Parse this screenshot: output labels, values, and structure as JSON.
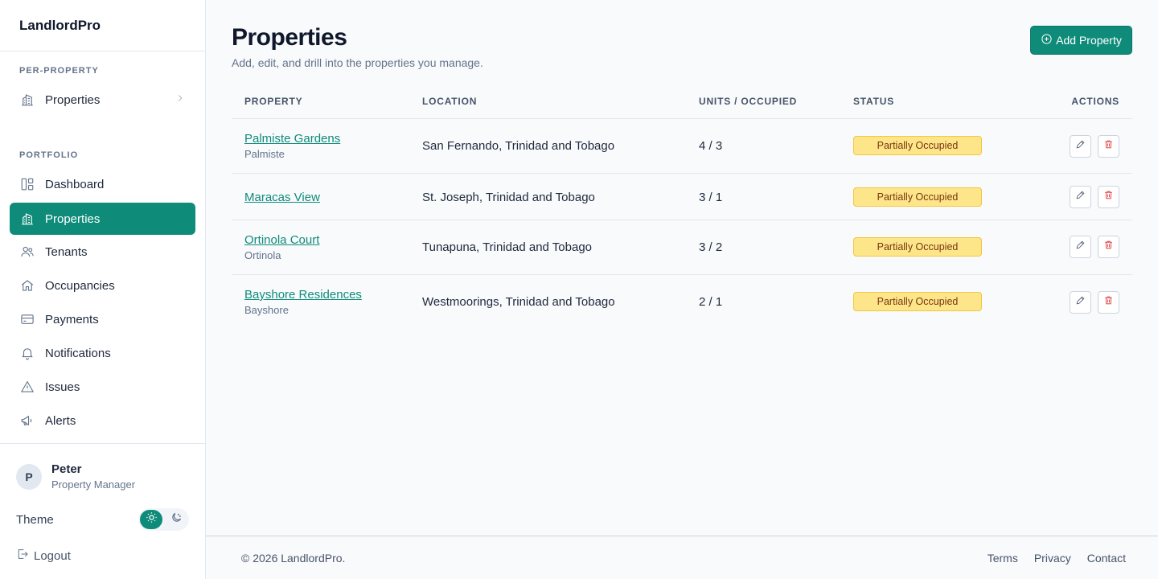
{
  "app": {
    "name": "LandlordPro"
  },
  "sidebar": {
    "per_property_label": "PER-PROPERTY",
    "per_property_item": {
      "label": "Properties",
      "icon": "building-icon"
    },
    "portfolio_label": "PORTFOLIO",
    "items": [
      {
        "label": "Dashboard",
        "icon": "dashboard-icon",
        "active": false
      },
      {
        "label": "Properties",
        "icon": "building-icon",
        "active": true
      },
      {
        "label": "Tenants",
        "icon": "users-icon",
        "active": false
      },
      {
        "label": "Occupancies",
        "icon": "home-icon",
        "active": false
      },
      {
        "label": "Payments",
        "icon": "credit-card-icon",
        "active": false
      },
      {
        "label": "Notifications",
        "icon": "bell-icon",
        "active": false
      },
      {
        "label": "Issues",
        "icon": "warning-icon",
        "active": false
      },
      {
        "label": "Alerts",
        "icon": "megaphone-icon",
        "active": false
      }
    ],
    "user": {
      "initial": "P",
      "name": "Peter",
      "role": "Property Manager"
    },
    "theme_label": "Theme",
    "logout_label": "Logout"
  },
  "main": {
    "title": "Properties",
    "subtitle": "Add, edit, and drill into the properties you manage.",
    "add_button": "Add Property",
    "columns": [
      "PROPERTY",
      "LOCATION",
      "UNITS / OCCUPIED",
      "STATUS",
      "ACTIONS"
    ],
    "rows": [
      {
        "name": "Palmiste Gardens",
        "sub": "Palmiste",
        "location": "San Fernando, Trinidad and Tobago",
        "units": "4 / 3",
        "status": "Partially Occupied"
      },
      {
        "name": "Maracas View",
        "sub": "",
        "location": "St. Joseph, Trinidad and Tobago",
        "units": "3 / 1",
        "status": "Partially Occupied"
      },
      {
        "name": "Ortinola Court",
        "sub": "Ortinola",
        "location": "Tunapuna, Trinidad and Tobago",
        "units": "3 / 2",
        "status": "Partially Occupied"
      },
      {
        "name": "Bayshore Residences",
        "sub": "Bayshore",
        "location": "Westmoorings, Trinidad and Tobago",
        "units": "2 / 1",
        "status": "Partially Occupied"
      }
    ]
  },
  "footer": {
    "copyright": "© 2026 LandlordPro.",
    "links": [
      "Terms",
      "Privacy",
      "Contact"
    ]
  },
  "colors": {
    "accent": "#0f8b7a",
    "badge_bg": "#fde68a",
    "badge_text": "#78350f",
    "danger": "#dc2626"
  }
}
